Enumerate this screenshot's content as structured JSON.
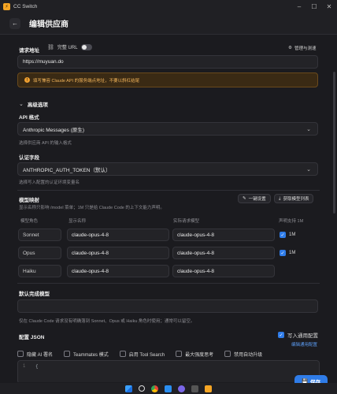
{
  "window": {
    "title": "CC Switch",
    "minimize": "–",
    "maximize": "☐",
    "close": "✕"
  },
  "header": {
    "back": "←",
    "title": "编辑供应商"
  },
  "endpoint": {
    "label": "请求地址",
    "full_url_toggle_label": "完整 URL",
    "manage_label": "管理与测速",
    "value": "https://muyuan.do",
    "warning": "填写兼容 Claude API 的服务端点地址，不要以斜杠结尾"
  },
  "advanced": {
    "title": "高级选项",
    "api_format": {
      "label": "API 格式",
      "value": "Anthropic Messages (原生)",
      "hint": "选择供应商 API 的输入格式"
    },
    "auth_field": {
      "label": "认证字段",
      "value": "ANTHROPIC_AUTH_TOKEN（默认）",
      "hint": "选择写入配置的认证环境变量名"
    }
  },
  "model_mapping": {
    "title": "模型映射",
    "hint": "显示名称只影响 /model 菜单；1M 只是给 Claude Code 的上下文能力声明。",
    "one_click_label": "一键设置",
    "fetch_label": "获取模型列表",
    "columns": [
      "模型角色",
      "显示名称",
      "实际请求模型",
      "声明支持 1M"
    ],
    "rows": [
      {
        "role": "Sonnet",
        "display": "claude-opus-4-8",
        "actual": "claude-opus-4-8",
        "one_m": "1M",
        "checked": true
      },
      {
        "role": "Opus",
        "display": "claude-opus-4-8",
        "actual": "claude-opus-4-8",
        "one_m": "1M",
        "checked": true
      },
      {
        "role": "Haiku",
        "display": "claude-opus-4-8",
        "actual": "claude-opus-4-8",
        "one_m": "",
        "checked": false
      }
    ]
  },
  "default_model": {
    "label": "默认完成模型",
    "value": "",
    "hint": "仅在 Claude Code 请求没有明确落到 Sonnet、Opus 或 Haiku 角色时使用；通常可以留空。"
  },
  "json_config": {
    "label": "配置 JSON",
    "write_common_label": "写入通用配置",
    "write_common_checked": true,
    "edit_common_label": "编辑通用配置",
    "options": [
      {
        "label": "隐藏 AI 署名"
      },
      {
        "label": "Teammates 模式"
      },
      {
        "label": "启用 Tool Search"
      },
      {
        "label": "最大强度思考"
      },
      {
        "label": "禁用自动升级"
      }
    ],
    "content": "{"
  },
  "save": {
    "label": "保存"
  },
  "colors": {
    "accent": "#2f7ce8",
    "warning": "#f0b35a",
    "background": "#1b1b1f"
  }
}
